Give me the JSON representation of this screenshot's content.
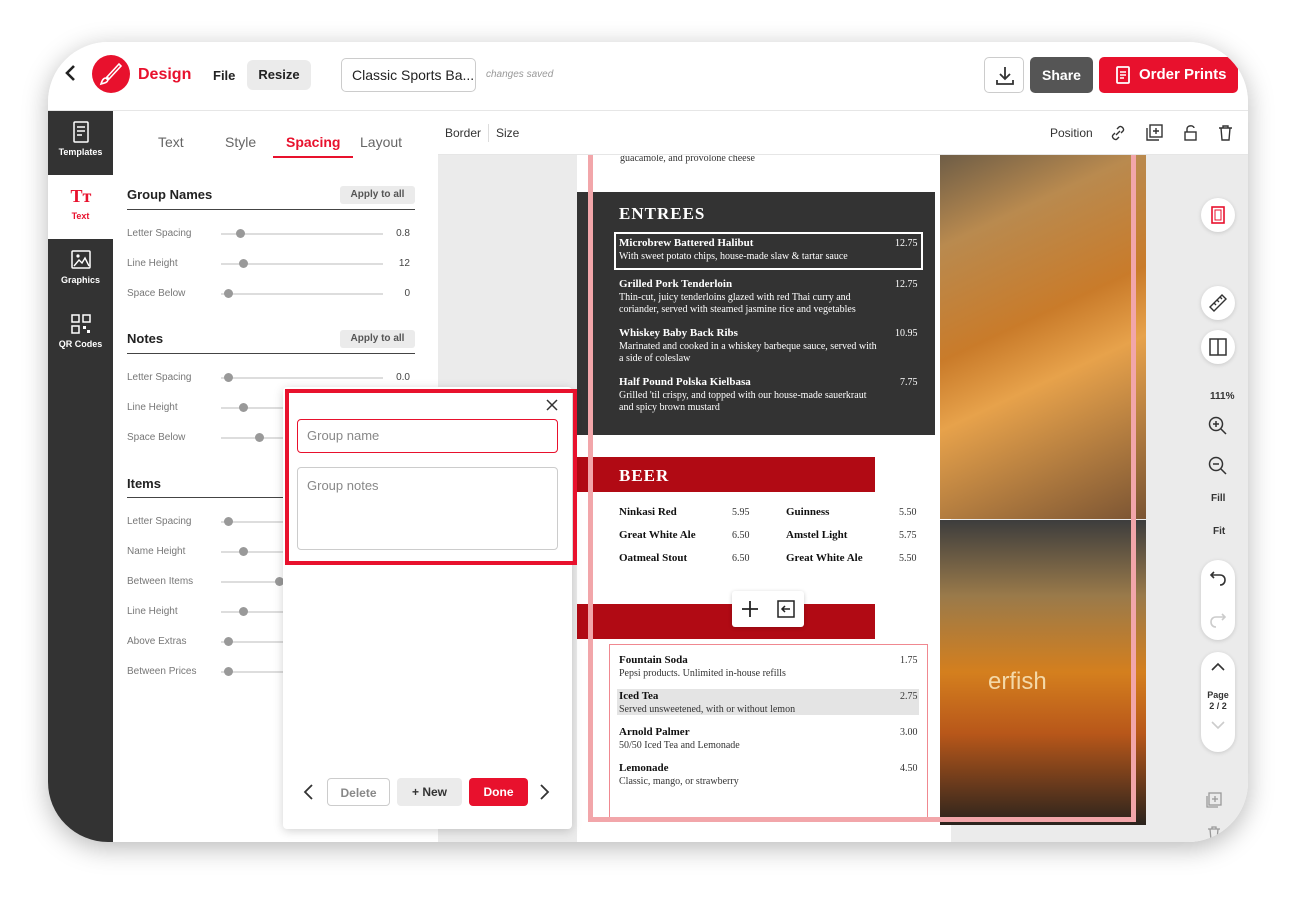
{
  "header": {
    "back_label": "‹",
    "brand": "Design",
    "file_label": "File",
    "resize_label": "Resize",
    "doc_title": "Classic Sports Ba...",
    "saved_status": "changes saved",
    "share_label": "Share",
    "order_label": "Order Prints"
  },
  "nav": {
    "items": [
      {
        "label": "Templates"
      },
      {
        "label": "Text"
      },
      {
        "label": "Graphics"
      },
      {
        "label": "QR Codes"
      }
    ]
  },
  "panel": {
    "tabs": [
      "Text",
      "Style",
      "Spacing",
      "Layout"
    ],
    "apply_label": "Apply to all",
    "group_names": {
      "title": "Group Names",
      "rows": [
        {
          "label": "Letter Spacing",
          "value": "0.8"
        },
        {
          "label": "Line Height",
          "value": "12"
        },
        {
          "label": "Space Below",
          "value": "0"
        }
      ]
    },
    "notes": {
      "title": "Notes",
      "rows": [
        {
          "label": "Letter Spacing",
          "value": "0.0"
        },
        {
          "label": "Line Height",
          "value": ""
        },
        {
          "label": "Space Below",
          "value": ""
        }
      ]
    },
    "items": {
      "title": "Items",
      "rows": [
        {
          "label": "Letter Spacing"
        },
        {
          "label": "Name Height"
        },
        {
          "label": "Between Items"
        },
        {
          "label": "Line Height"
        },
        {
          "label": "Above Extras"
        },
        {
          "label": "Between Prices"
        }
      ]
    }
  },
  "canvas_toolbar": {
    "border_label": "Border",
    "size_label": "Size",
    "position_label": "Position"
  },
  "menu": {
    "top_text": "guacamole, and provolone cheese",
    "entrees_title": "ENTREES",
    "entrees": [
      {
        "name": "Microbrew Battered Halibut",
        "price": "12.75",
        "desc": "With sweet potato chips, house-made slaw & tartar sauce"
      },
      {
        "name": "Grilled Pork Tenderloin",
        "price": "12.75",
        "desc": "Thin-cut, juicy tenderloins glazed with red Thai curry and",
        "desc2": "coriander, served with steamed jasmine rice and vegetables"
      },
      {
        "name": "Whiskey Baby Back Ribs",
        "price": "10.95",
        "desc": "Marinated and cooked in a whiskey barbeque sauce, served with",
        "desc2": "a side of coleslaw"
      },
      {
        "name": "Half Pound Polska Kielbasa",
        "price": "7.75",
        "desc": "Grilled 'til crispy, and topped with our house-made sauerkraut",
        "desc2": "and spicy brown mustard"
      }
    ],
    "beer_title": "BEER",
    "beers_left": [
      {
        "name": "Ninkasi Red",
        "price": "5.95"
      },
      {
        "name": "Great White Ale",
        "price": "6.50"
      },
      {
        "name": "Oatmeal Stout",
        "price": "6.50"
      }
    ],
    "beers_right": [
      {
        "name": "Guinness",
        "price": "5.50"
      },
      {
        "name": "Amstel Light",
        "price": "5.75"
      },
      {
        "name": "Great White Ale",
        "price": "5.50"
      }
    ],
    "drinks": [
      {
        "name": "Fountain Soda",
        "price": "1.75",
        "desc": "Pepsi products. Unlimited in-house refills"
      },
      {
        "name": "Iced Tea",
        "price": "2.75",
        "desc": "Served unsweetened, with or without lemon"
      },
      {
        "name": "Arnold Palmer",
        "price": "3.00",
        "desc": "50/50 Iced Tea and Lemonade"
      },
      {
        "name": "Lemonade",
        "price": "4.50",
        "desc": "Classic, mango, or strawberry"
      }
    ],
    "photo_sign_text": "erfish"
  },
  "right_tools": {
    "zoom": "111%",
    "fill_label": "Fill",
    "fit_label": "Fit",
    "page_label": "Page",
    "page_num": "2 / 2"
  },
  "popup": {
    "group_name_placeholder": "Group name",
    "group_notes_placeholder": "Group notes",
    "delete_label": "Delete",
    "new_label": "+ New",
    "done_label": "Done"
  },
  "colors": {
    "accent": "#e8112d",
    "dark": "#333333",
    "ribbon": "#b10a14"
  }
}
